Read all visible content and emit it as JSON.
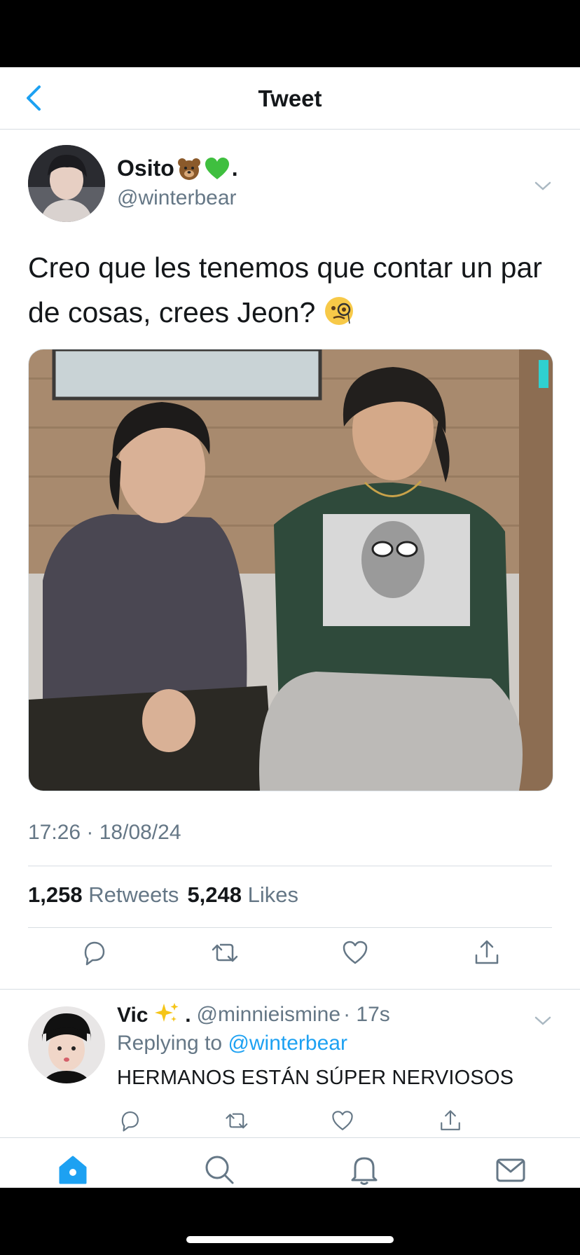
{
  "nav": {
    "title": "Tweet"
  },
  "tweet": {
    "display_name": "Osito",
    "name_suffix": ".",
    "handle": "@winterbear",
    "text": "Creo que les tenemos que contar un par de cosas, crees Jeon?",
    "timestamp": "17:26 · 18/08/24",
    "retweets_count": "1,258",
    "retweets_label": "Retweets",
    "likes_count": "5,248",
    "likes_label": "Likes"
  },
  "reply": {
    "display_name": "Vic",
    "name_suffix": ".",
    "handle": "@minnieismine",
    "time": "· 17s",
    "replying_prefix": "Replying to",
    "replying_handle": "@winterbear",
    "text": "HERMANOS ESTÁN SÚPER NERVIOSOS"
  },
  "colors": {
    "accent": "#1da1f2",
    "muted": "#657786",
    "text": "#14171a",
    "heart_emoji": "#3fbf3f"
  },
  "icons": [
    "back-arrow-icon",
    "chevron-down-icon",
    "reply-icon",
    "retweet-icon",
    "like-icon",
    "share-icon",
    "home-icon",
    "search-icon",
    "notifications-icon",
    "messages-icon"
  ]
}
